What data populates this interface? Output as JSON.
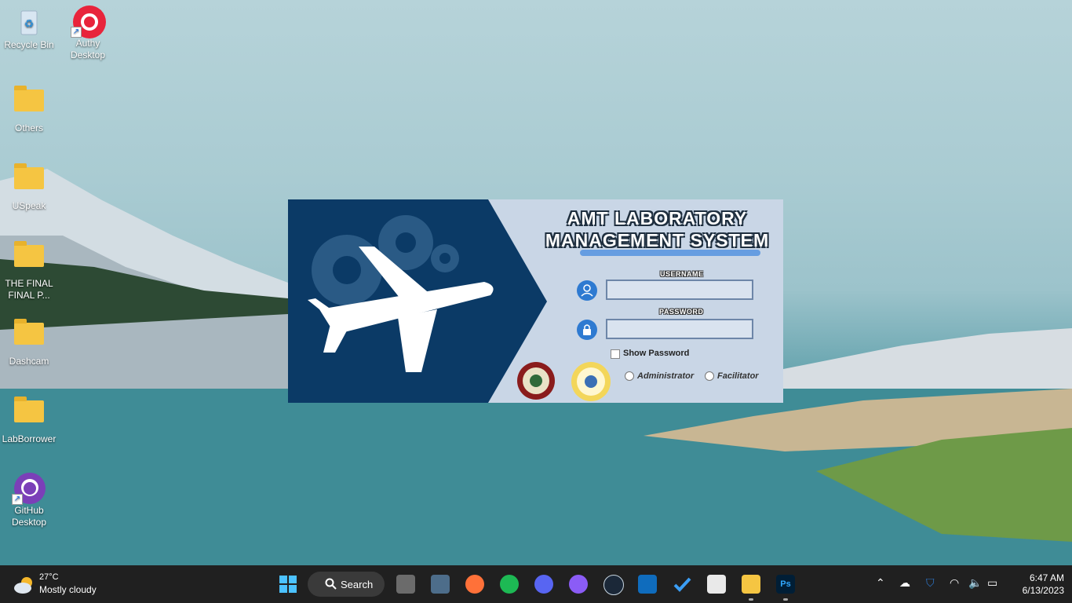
{
  "desktop": {
    "icons": [
      {
        "label": "Recycle Bin",
        "icon": "recycle-bin-icon"
      },
      {
        "label": "Authy Desktop",
        "icon": "authy-icon"
      },
      {
        "label": "Others",
        "icon": "folder-icon"
      },
      {
        "label": "USpeak",
        "icon": "folder-icon"
      },
      {
        "label": "THE FINAL FINAL P...",
        "icon": "folder-icon"
      },
      {
        "label": "Dashcam",
        "icon": "folder-icon"
      },
      {
        "label": "LabBorrower",
        "icon": "folder-icon"
      },
      {
        "label": "GitHub Desktop",
        "icon": "github-icon"
      }
    ]
  },
  "login": {
    "title_line1": "AMT LABORATORY",
    "title_line2": "MANAGEMENT SYSTEM",
    "username_label": "USERNAME",
    "username_value": "",
    "password_label": "PASSWORD",
    "password_value": "",
    "show_password_label": "Show Password",
    "show_password_checked": false,
    "roles": [
      {
        "label": "Administrator",
        "selected": false
      },
      {
        "label": "Facilitator",
        "selected": false
      }
    ],
    "colors": {
      "panel_dark": "#0b3a66",
      "accent": "#2e7ad1"
    }
  },
  "taskbar": {
    "weather": {
      "temp": "27°C",
      "condition": "Mostly cloudy"
    },
    "search_label": "Search",
    "apps": [
      "start-icon",
      "search",
      "task-view-icon",
      "calculator-icon",
      "firefox-icon",
      "spotify-icon",
      "discord-icon",
      "messenger-icon",
      "steam-icon",
      "outlook-icon",
      "todo-icon",
      "store-icon",
      "file-explorer-icon",
      "photoshop-icon"
    ],
    "time": "6:47 AM",
    "date": "6/13/2023"
  }
}
